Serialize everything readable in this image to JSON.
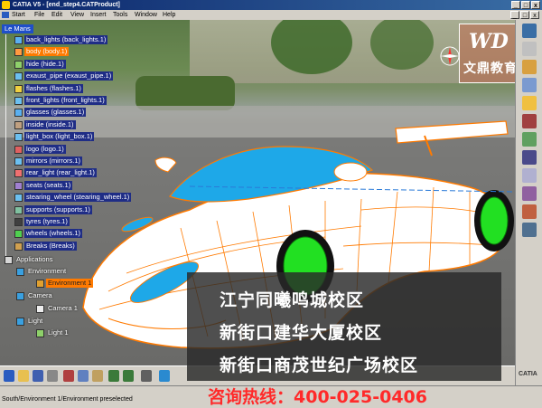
{
  "window": {
    "title": "CATIA V5 - [end_step4.CATProduct]",
    "controls": [
      "_",
      "□",
      "x"
    ]
  },
  "menu": {
    "items": [
      "Start",
      "File",
      "Edit",
      "View",
      "Insert",
      "Tools",
      "Window",
      "Help"
    ]
  },
  "tree": {
    "root": "Le Mans",
    "items": [
      {
        "label": "back_lights (back_lights.1)",
        "selected": false
      },
      {
        "label": "body (body.1)",
        "selected": true
      },
      {
        "label": "hide (hide.1)",
        "selected": false
      },
      {
        "label": "exaust_pipe (exaust_pipe.1)",
        "selected": false
      },
      {
        "label": "flashes (flashes.1)",
        "selected": false
      },
      {
        "label": "front_lights (front_lights.1)",
        "selected": false
      },
      {
        "label": "glasses (glasses.1)",
        "selected": false
      },
      {
        "label": "inside (inside.1)",
        "selected": false
      },
      {
        "label": "light_box (light_box.1)",
        "selected": false
      },
      {
        "label": "logo (logo.1)",
        "selected": false
      },
      {
        "label": "mirrors (mirrors.1)",
        "selected": false
      },
      {
        "label": "rear_light (rear_light.1)",
        "selected": false
      },
      {
        "label": "seats (seats.1)",
        "selected": false
      },
      {
        "label": "stearing_wheel (stearing_wheel.1)",
        "selected": false
      },
      {
        "label": "supports (supports.1)",
        "selected": false
      },
      {
        "label": "tyres (tyres.1)",
        "selected": false
      },
      {
        "label": "wheels (wheels.1)",
        "selected": false
      },
      {
        "label": "Breaks (Breaks)",
        "selected": false
      }
    ],
    "applications": {
      "label": "Applications",
      "environment_group": "Environment",
      "environment_item": "Environment 1",
      "camera_group": "Camera",
      "camera_item": "Camera 1",
      "light_group": "Light",
      "light_item": "Light 1"
    }
  },
  "overlay": {
    "logo_mark": "WD",
    "logo_name": "文鼎教育",
    "ad_lines": [
      "江宁同曦鸣城校区",
      "新街口建华大厦校区",
      "新街口商茂世纪广场校区"
    ],
    "hotline": "咨询热线：400-025-0406"
  },
  "status": {
    "text": "South/Environment 1/Environment preselected"
  },
  "catia_label": "CATIA",
  "colors": {
    "title_bar": "#0a246a",
    "tree_node": "#1f2d86",
    "selected_node": "#ff7a00",
    "car_body": "#ffffff",
    "wireframe": "#ff7a00",
    "glass": "#1ea8e8",
    "wheels": "#22e022",
    "hotline": "#ff2a2a"
  }
}
